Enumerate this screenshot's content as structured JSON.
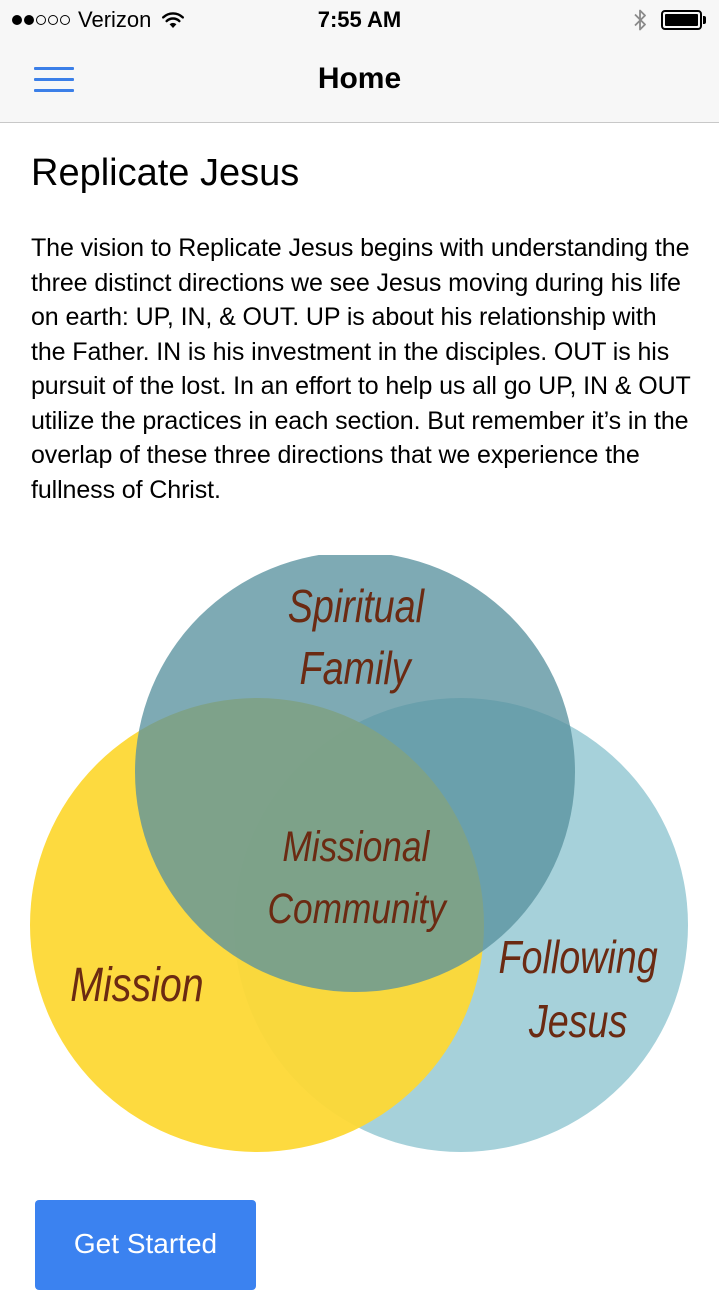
{
  "status_bar": {
    "signal_filled": 2,
    "signal_total": 5,
    "carrier": "Verizon",
    "time": "7:55 AM",
    "battery_level": 1.0
  },
  "nav": {
    "title": "Home",
    "menu_icon": "hamburger-menu-icon"
  },
  "content": {
    "title": "Replicate Jesus",
    "description": "The vision to Replicate Jesus begins with understanding the three distinct directions we see Jesus moving during his life on earth: UP, IN, & OUT. UP is about his relationship with the Father. IN is his investment in the disciples. OUT is his pursuit of the lost. In an effort to help us all go UP, IN & OUT utilize the practices in each section. But remember it’s in the overlap of these three directions that we experience the fullness of Christ."
  },
  "venn": {
    "top_circle": {
      "line1": "Spiritual",
      "line2": "Family",
      "color": "#5a929f"
    },
    "left_circle": {
      "label": "Mission",
      "color": "#fdd835"
    },
    "right_circle": {
      "line1": "Following",
      "line2": "Jesus",
      "color": "#a6d1da"
    },
    "center": {
      "line1": "Missional",
      "line2": "Community"
    },
    "text_color": "#6b2a12"
  },
  "actions": {
    "get_started_label": "Get Started"
  },
  "colors": {
    "accent": "#3b82f0",
    "nav_background": "#f7f7f7"
  }
}
